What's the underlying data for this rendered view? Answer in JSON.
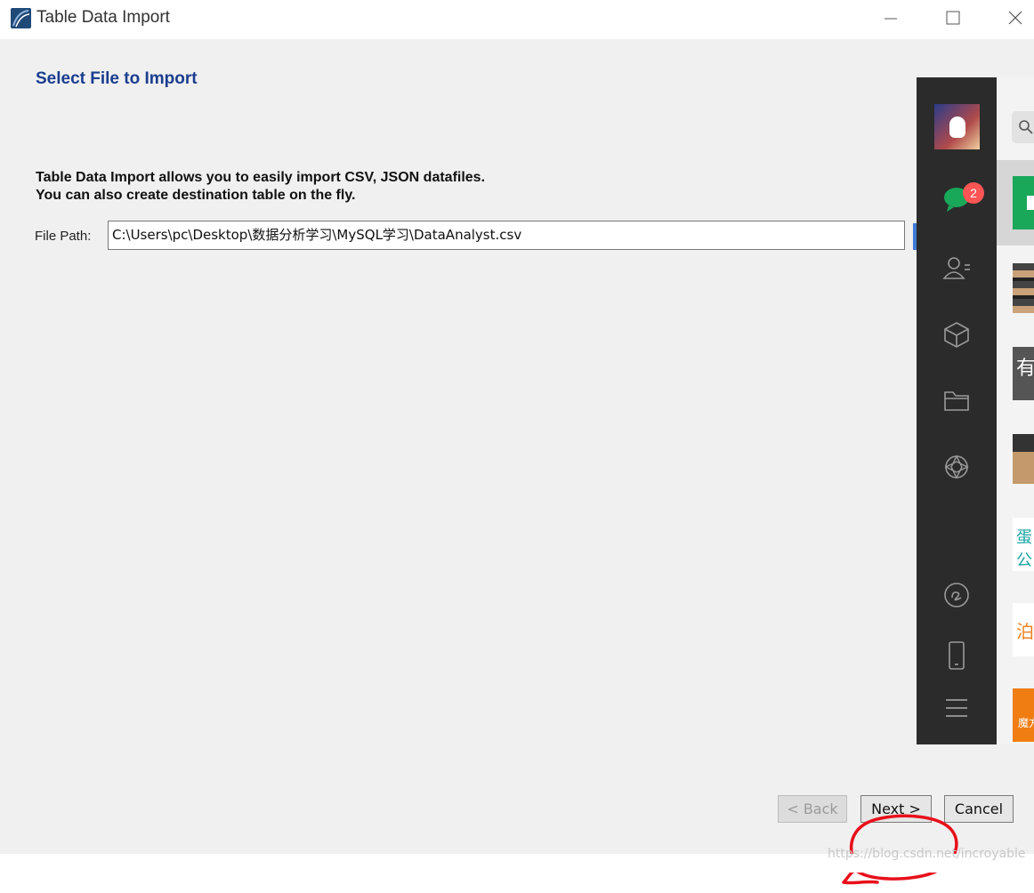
{
  "window": {
    "title": "Table Data Import",
    "controls": [
      "minimize",
      "maximize",
      "close"
    ]
  },
  "main": {
    "section_title": "Select File to Import",
    "description_line1": "Table Data Import allows you to easily import CSV, JSON datafiles.",
    "description_line2": "You can also create destination table on the fly.",
    "file_path_label": "File Path:",
    "file_path_value": "C:\\Users\\pc\\Desktop\\数据分析学习\\MySQL学习\\DataAnalyst.csv"
  },
  "footer": {
    "back_label": "< Back",
    "next_label": "Next >",
    "cancel_label": "Cancel",
    "back_enabled": false
  },
  "annotation": {
    "type": "red hand-drawn circle around Next button",
    "color": "#e8101a"
  },
  "watermark": "https://blog.csdn.net/incroyable",
  "overlay_app": {
    "unread_badge": "2",
    "sidebar_icons": [
      "chat-icon",
      "contacts-icon",
      "box-icon",
      "folder-icon",
      "moments-icon",
      "mini-program-icon",
      "phone-icon",
      "menu-icon"
    ],
    "list_thumbnails": [
      "有",
      "蛋公",
      "泊",
      "魔方"
    ]
  },
  "colors": {
    "title_blue": "#1b3d8f",
    "dialog_bg": "#f0f0f0",
    "chat_sidebar": "#2b2b2b",
    "chat_green": "#19a75a",
    "badge_red": "#f55555"
  }
}
